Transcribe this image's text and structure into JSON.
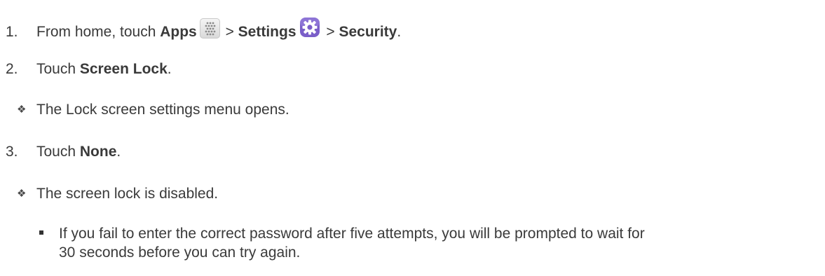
{
  "steps": [
    {
      "number": "1.",
      "text_a": "From home, touch ",
      "bold_a": "Apps",
      "sep_a": " > ",
      "bold_b": "Settings",
      "sep_b": " > ",
      "bold_c": "Security",
      "end": ".",
      "icons": [
        "apps-grid-icon",
        "settings-gear-icon"
      ]
    },
    {
      "number": "2.",
      "text_a": "Touch ",
      "bold_a": "Screen Lock",
      "end": "."
    },
    {
      "number": "3.",
      "text_a": "Touch ",
      "bold_a": "None",
      "end": "."
    }
  ],
  "results": {
    "step2": "The Lock screen settings menu opens.",
    "step3": "The screen lock is disabled."
  },
  "note": {
    "line1": "If you fail to enter the correct password after five attempts, you will be prompted to wait for",
    "line2": "30 seconds before you can try again."
  },
  "colors": {
    "text": "#3a3a3a",
    "settings_icon": "#7b5fc9"
  }
}
